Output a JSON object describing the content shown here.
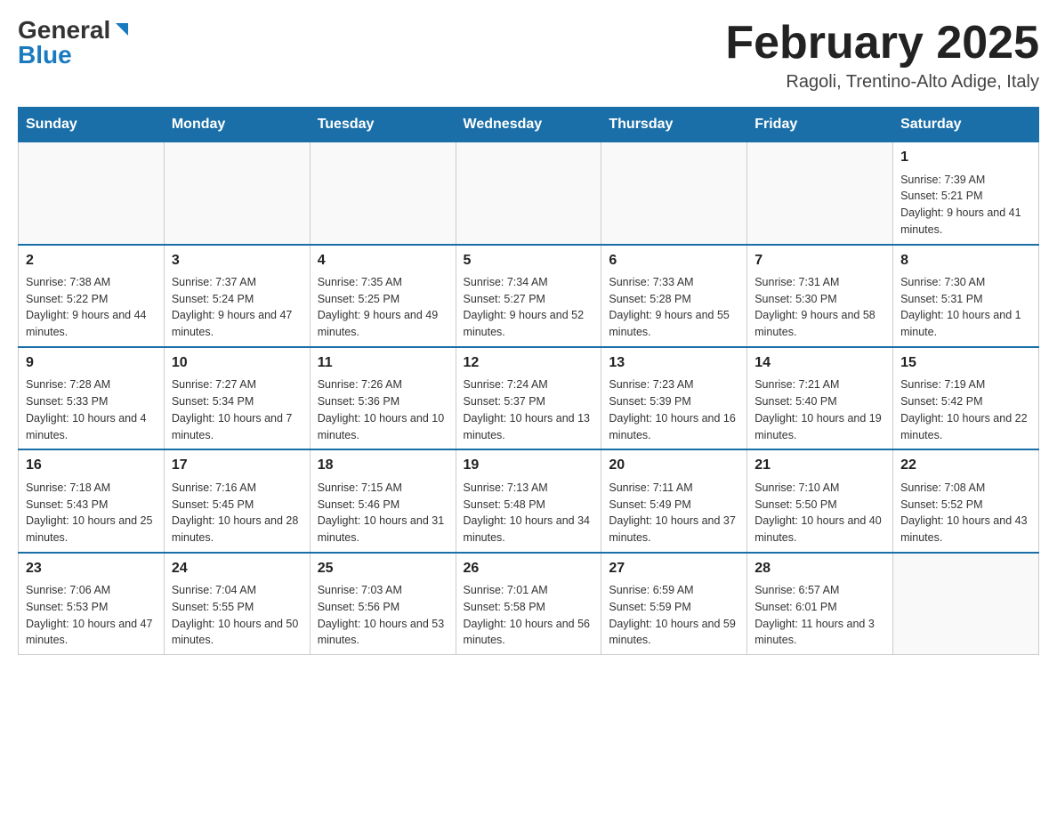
{
  "logo": {
    "general": "General",
    "blue": "Blue",
    "arrow": "▶"
  },
  "title": "February 2025",
  "subtitle": "Ragoli, Trentino-Alto Adige, Italy",
  "days_of_week": [
    "Sunday",
    "Monday",
    "Tuesday",
    "Wednesday",
    "Thursday",
    "Friday",
    "Saturday"
  ],
  "weeks": [
    {
      "days": [
        {
          "number": "",
          "info": ""
        },
        {
          "number": "",
          "info": ""
        },
        {
          "number": "",
          "info": ""
        },
        {
          "number": "",
          "info": ""
        },
        {
          "number": "",
          "info": ""
        },
        {
          "number": "",
          "info": ""
        },
        {
          "number": "1",
          "info": "Sunrise: 7:39 AM\nSunset: 5:21 PM\nDaylight: 9 hours and 41 minutes."
        }
      ]
    },
    {
      "days": [
        {
          "number": "2",
          "info": "Sunrise: 7:38 AM\nSunset: 5:22 PM\nDaylight: 9 hours and 44 minutes."
        },
        {
          "number": "3",
          "info": "Sunrise: 7:37 AM\nSunset: 5:24 PM\nDaylight: 9 hours and 47 minutes."
        },
        {
          "number": "4",
          "info": "Sunrise: 7:35 AM\nSunset: 5:25 PM\nDaylight: 9 hours and 49 minutes."
        },
        {
          "number": "5",
          "info": "Sunrise: 7:34 AM\nSunset: 5:27 PM\nDaylight: 9 hours and 52 minutes."
        },
        {
          "number": "6",
          "info": "Sunrise: 7:33 AM\nSunset: 5:28 PM\nDaylight: 9 hours and 55 minutes."
        },
        {
          "number": "7",
          "info": "Sunrise: 7:31 AM\nSunset: 5:30 PM\nDaylight: 9 hours and 58 minutes."
        },
        {
          "number": "8",
          "info": "Sunrise: 7:30 AM\nSunset: 5:31 PM\nDaylight: 10 hours and 1 minute."
        }
      ]
    },
    {
      "days": [
        {
          "number": "9",
          "info": "Sunrise: 7:28 AM\nSunset: 5:33 PM\nDaylight: 10 hours and 4 minutes."
        },
        {
          "number": "10",
          "info": "Sunrise: 7:27 AM\nSunset: 5:34 PM\nDaylight: 10 hours and 7 minutes."
        },
        {
          "number": "11",
          "info": "Sunrise: 7:26 AM\nSunset: 5:36 PM\nDaylight: 10 hours and 10 minutes."
        },
        {
          "number": "12",
          "info": "Sunrise: 7:24 AM\nSunset: 5:37 PM\nDaylight: 10 hours and 13 minutes."
        },
        {
          "number": "13",
          "info": "Sunrise: 7:23 AM\nSunset: 5:39 PM\nDaylight: 10 hours and 16 minutes."
        },
        {
          "number": "14",
          "info": "Sunrise: 7:21 AM\nSunset: 5:40 PM\nDaylight: 10 hours and 19 minutes."
        },
        {
          "number": "15",
          "info": "Sunrise: 7:19 AM\nSunset: 5:42 PM\nDaylight: 10 hours and 22 minutes."
        }
      ]
    },
    {
      "days": [
        {
          "number": "16",
          "info": "Sunrise: 7:18 AM\nSunset: 5:43 PM\nDaylight: 10 hours and 25 minutes."
        },
        {
          "number": "17",
          "info": "Sunrise: 7:16 AM\nSunset: 5:45 PM\nDaylight: 10 hours and 28 minutes."
        },
        {
          "number": "18",
          "info": "Sunrise: 7:15 AM\nSunset: 5:46 PM\nDaylight: 10 hours and 31 minutes."
        },
        {
          "number": "19",
          "info": "Sunrise: 7:13 AM\nSunset: 5:48 PM\nDaylight: 10 hours and 34 minutes."
        },
        {
          "number": "20",
          "info": "Sunrise: 7:11 AM\nSunset: 5:49 PM\nDaylight: 10 hours and 37 minutes."
        },
        {
          "number": "21",
          "info": "Sunrise: 7:10 AM\nSunset: 5:50 PM\nDaylight: 10 hours and 40 minutes."
        },
        {
          "number": "22",
          "info": "Sunrise: 7:08 AM\nSunset: 5:52 PM\nDaylight: 10 hours and 43 minutes."
        }
      ]
    },
    {
      "days": [
        {
          "number": "23",
          "info": "Sunrise: 7:06 AM\nSunset: 5:53 PM\nDaylight: 10 hours and 47 minutes."
        },
        {
          "number": "24",
          "info": "Sunrise: 7:04 AM\nSunset: 5:55 PM\nDaylight: 10 hours and 50 minutes."
        },
        {
          "number": "25",
          "info": "Sunrise: 7:03 AM\nSunset: 5:56 PM\nDaylight: 10 hours and 53 minutes."
        },
        {
          "number": "26",
          "info": "Sunrise: 7:01 AM\nSunset: 5:58 PM\nDaylight: 10 hours and 56 minutes."
        },
        {
          "number": "27",
          "info": "Sunrise: 6:59 AM\nSunset: 5:59 PM\nDaylight: 10 hours and 59 minutes."
        },
        {
          "number": "28",
          "info": "Sunrise: 6:57 AM\nSunset: 6:01 PM\nDaylight: 11 hours and 3 minutes."
        },
        {
          "number": "",
          "info": ""
        }
      ]
    }
  ]
}
